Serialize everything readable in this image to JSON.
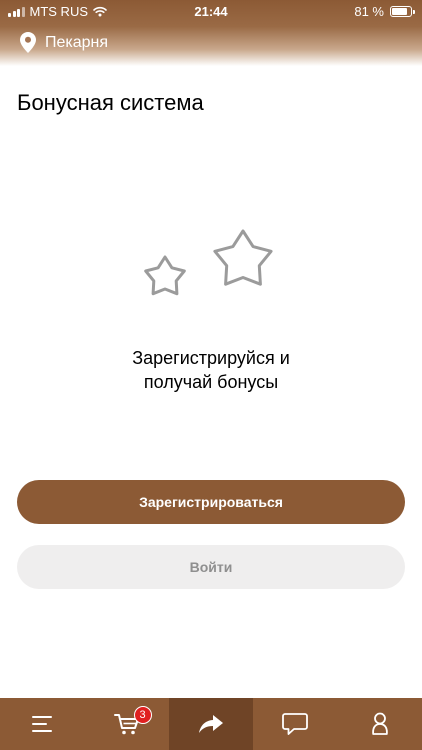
{
  "status_bar": {
    "carrier": "MTS RUS",
    "time": "21:44",
    "battery": "81 %"
  },
  "header": {
    "location": "Пекарня"
  },
  "page": {
    "title": "Бонусная система"
  },
  "promo": {
    "line1": "Зарегистрируйся и",
    "line2": "получай бонусы"
  },
  "buttons": {
    "register": "Зарегистрироваться",
    "login": "Войти"
  },
  "tabbar": {
    "cart_badge": "3"
  },
  "colors": {
    "brand": "#8c5a35",
    "brand_dark": "#6f4426",
    "secondary_button": "#efeeee",
    "badge": "#e02020"
  }
}
